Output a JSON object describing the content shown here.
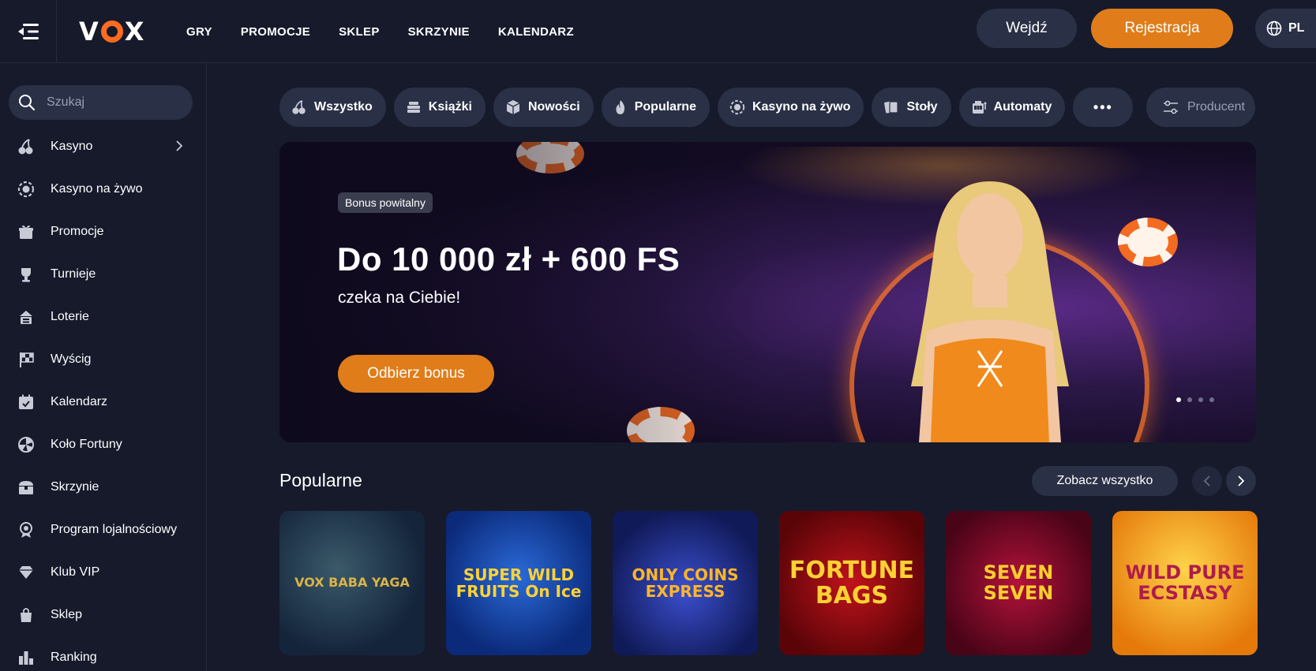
{
  "header": {
    "logo": "VOX",
    "nav": [
      "GRY",
      "PROMOCJE",
      "SKLEP",
      "SKRZYNIE",
      "KALENDARZ"
    ],
    "login_label": "Wejdź",
    "register_label": "Rejestracja",
    "lang": "PL"
  },
  "sidebar": {
    "search_placeholder": "Szukaj",
    "items": [
      {
        "label": "Kasyno",
        "icon": "cherries-icon"
      },
      {
        "label": "Kasyno na żywo",
        "icon": "chip-icon"
      },
      {
        "label": "Promocje",
        "icon": "gift-icon"
      },
      {
        "label": "Turnieje",
        "icon": "trophy-icon"
      },
      {
        "label": "Loterie",
        "icon": "lottery-icon"
      },
      {
        "label": "Wyścig",
        "icon": "race-flag-icon"
      },
      {
        "label": "Kalendarz",
        "icon": "calendar-icon"
      },
      {
        "label": "Koło Fortuny",
        "icon": "wheel-icon"
      },
      {
        "label": "Skrzynie",
        "icon": "chest-icon"
      },
      {
        "label": "Program lojalnościowy",
        "icon": "medal-icon"
      },
      {
        "label": "Klub VIP",
        "icon": "diamond-icon"
      },
      {
        "label": "Sklep",
        "icon": "bag-icon"
      },
      {
        "label": "Ranking",
        "icon": "ranking-icon"
      }
    ]
  },
  "categories": [
    "Wszystko",
    "Książki",
    "Nowości",
    "Popularne",
    "Kasyno na żywo",
    "Stoły",
    "Automaty"
  ],
  "more_label": "•••",
  "producer_label": "Producent",
  "banner": {
    "badge": "Bonus powitalny",
    "title": "Do 10 000 zł + 600 FS",
    "subtitle": "czeka na Ciebie!",
    "cta": "Odbierz bonus",
    "slides": 4,
    "active_slide": 1
  },
  "popular": {
    "title": "Popularne",
    "see_all": "Zobacz wszystko",
    "games": [
      {
        "title": "VOX BABA YAGA",
        "color": "#d9b24a"
      },
      {
        "title": "SUPER WILD FRUITS On Ice",
        "color": "#ffd233"
      },
      {
        "title": "ONLY COINS EXPRESS",
        "color": "#ffb627"
      },
      {
        "title": "FORTUNE BAGS",
        "color": "#ffd233"
      },
      {
        "title": "SEVEN SEVEN",
        "color": "#ffcf2e"
      },
      {
        "title": "WILD PURE ECSTASY",
        "color": "#b01c4a"
      }
    ]
  }
}
